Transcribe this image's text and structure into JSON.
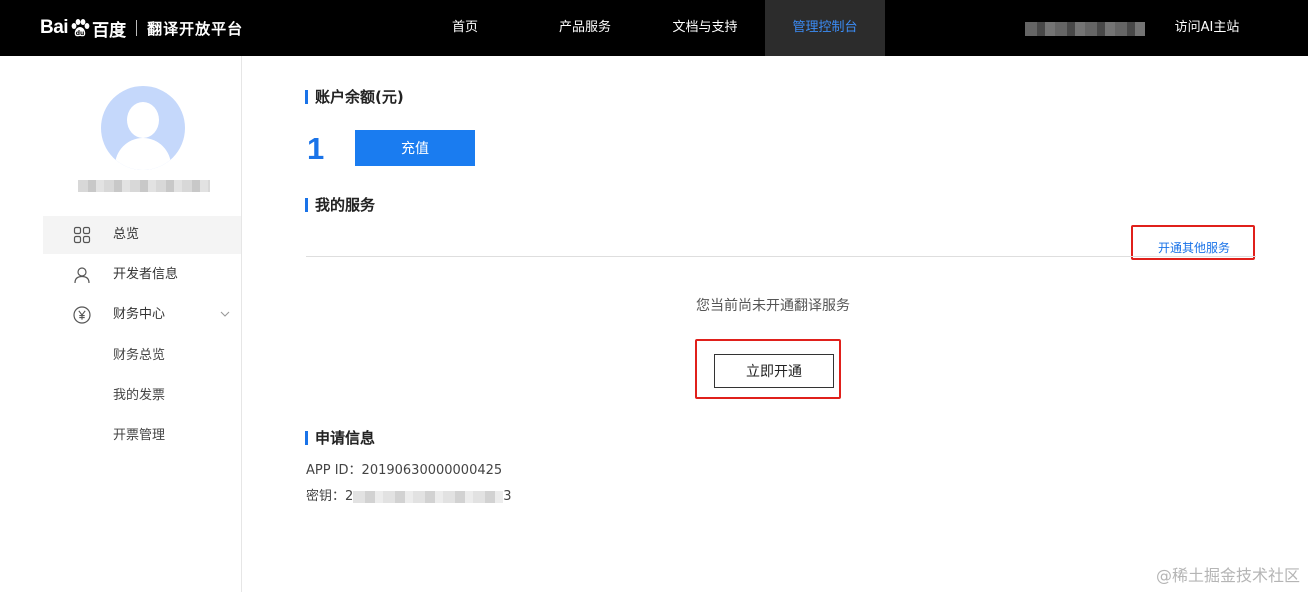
{
  "header": {
    "logo_text": "Bai",
    "logo_du": "百度",
    "platform": "翻译开放平台",
    "nav": [
      {
        "label": "首页"
      },
      {
        "label": "产品服务"
      },
      {
        "label": "文档与支持"
      },
      {
        "label": "管理控制台",
        "active": true
      }
    ],
    "visit_ai": "访问AI主站"
  },
  "sidebar": {
    "menu": [
      {
        "label": "总览",
        "icon": "grid-icon",
        "active": true
      },
      {
        "label": "开发者信息",
        "icon": "user-icon"
      },
      {
        "label": "财务中心",
        "icon": "yen-icon",
        "expandable": true
      }
    ],
    "submenu": [
      {
        "label": "财务总览"
      },
      {
        "label": "我的发票"
      },
      {
        "label": "开票管理"
      }
    ]
  },
  "account": {
    "title": "账户余额(元)",
    "balance": "1",
    "recharge_label": "充值"
  },
  "services": {
    "title": "我的服务",
    "open_other_label": "开通其他服务",
    "empty_text": "您当前尚未开通翻译服务",
    "open_now_label": "立即开通"
  },
  "application": {
    "title": "申请信息",
    "app_id_line": "APP ID：20190630000000425",
    "secret_label": "密钥：",
    "secret_prefix": "2",
    "secret_suffix": "3"
  },
  "watermark": "@稀土掘金技术社区",
  "colors": {
    "accent": "#1a73e8",
    "highlight_box": "#e0201b",
    "header_bg": "#000000"
  }
}
